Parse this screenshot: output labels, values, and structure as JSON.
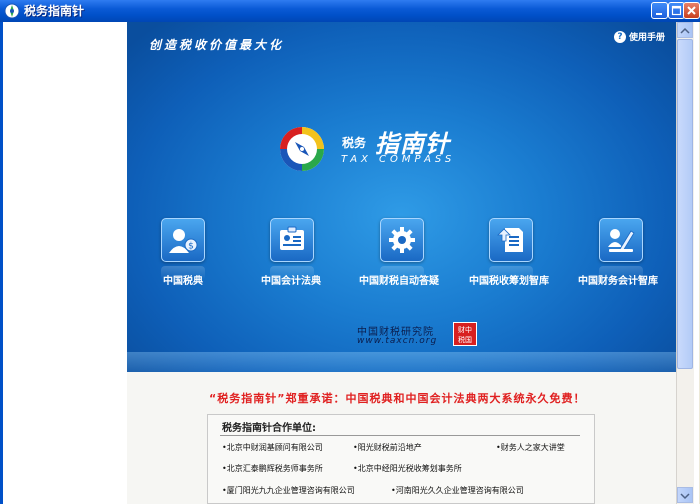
{
  "window": {
    "title": "税务指南针"
  },
  "header": {
    "slogan": "创造税收价值最大化",
    "manual_label": "使用手册",
    "manual_glyph": "?"
  },
  "logo": {
    "cn_small": "税务",
    "cn_big": "指南针",
    "en": "TAX COMPASS"
  },
  "modules": [
    {
      "label": "中国税典",
      "icon": "user-coin-icon"
    },
    {
      "label": "中国会计法典",
      "icon": "id-card-icon"
    },
    {
      "label": "中国财税自动答疑",
      "icon": "gear-icon"
    },
    {
      "label": "中国税收筹划智库",
      "icon": "document-arrow-icon"
    },
    {
      "label": "中国财务会计智库",
      "icon": "pen-tools-icon"
    }
  ],
  "institute": {
    "name": "中国财税研究院",
    "url": "www.taxcn.org",
    "seal_line1": "财中",
    "seal_line2": "税国"
  },
  "promise": "“税务指南针”郑重承诺：中国税典和中国会计法典两大系统永久免费！",
  "partners": {
    "title": "税务指南针合作单位:",
    "items": [
      "•北京中财润基顾问有限公司",
      "•阳光财税前沿地产",
      "•财务人之家大讲堂",
      "•北京汇泰鹏辉税务师事务所",
      "•北京中经阳光税收筹划事务所",
      "•厦门阳光九九企业管理咨询有限公司",
      "•河南阳光久久企业管理咨询有限公司"
    ]
  },
  "colors": {
    "title_bar": "#0050c8",
    "main_bg": "#1a7cd0",
    "promise": "#e02020",
    "seal": "#d82020"
  }
}
